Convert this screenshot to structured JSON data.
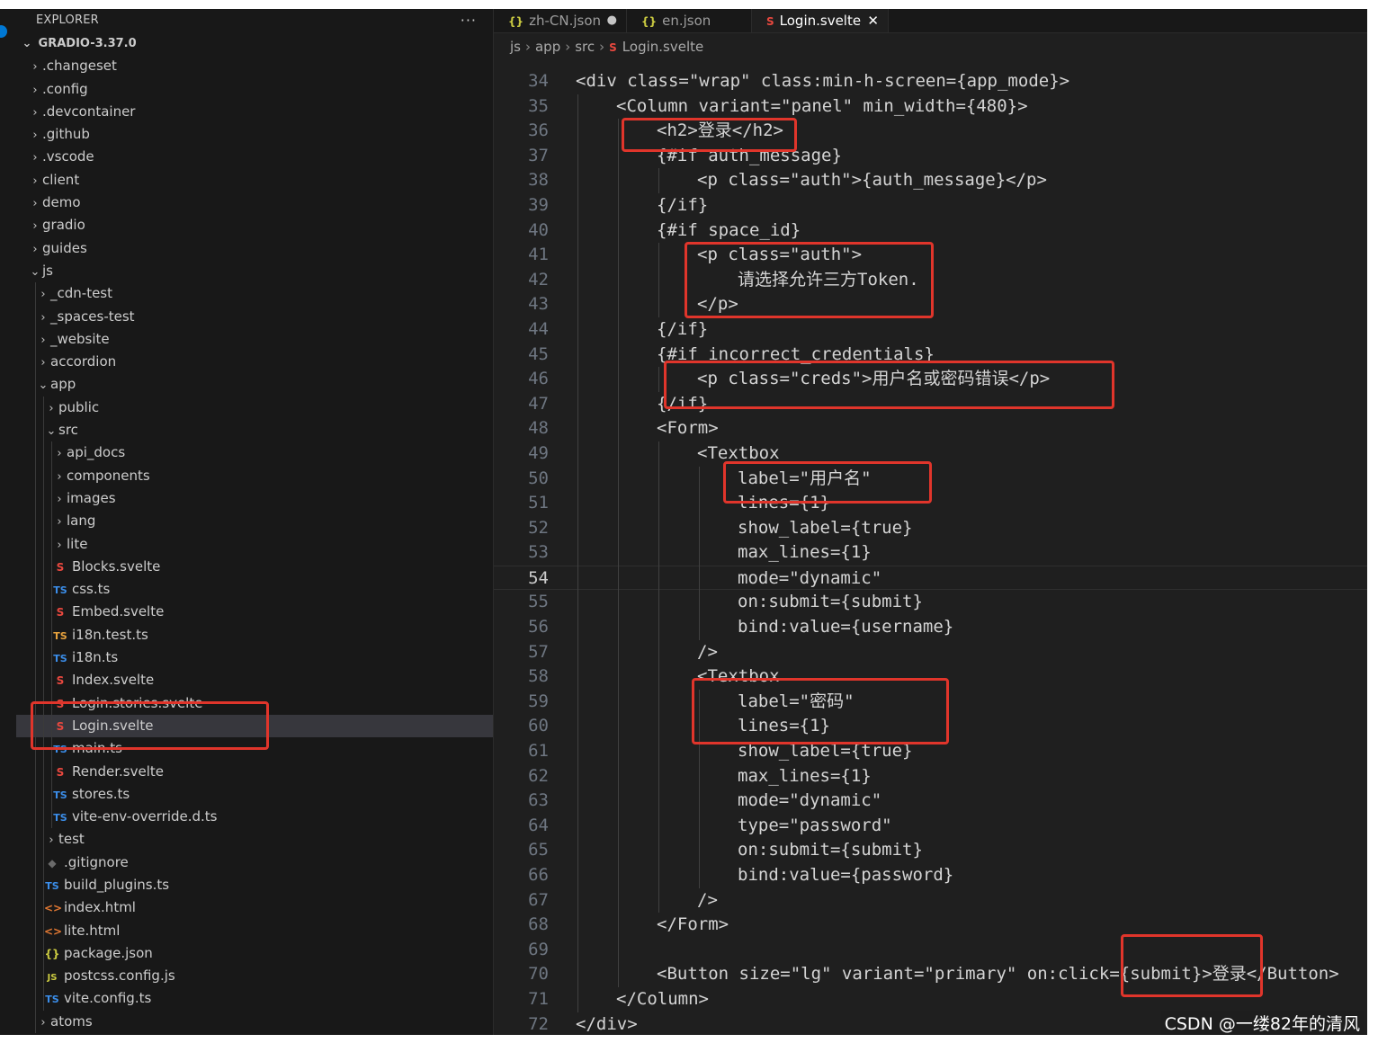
{
  "sidebar": {
    "title": "EXPLORER",
    "more": "···",
    "root": "GRADIO-3.37.0",
    "items": [
      {
        "label": ".changeset",
        "type": "folder",
        "depth": 1,
        "open": false
      },
      {
        "label": ".config",
        "type": "folder",
        "depth": 1,
        "open": false
      },
      {
        "label": ".devcontainer",
        "type": "folder",
        "depth": 1,
        "open": false
      },
      {
        "label": ".github",
        "type": "folder",
        "depth": 1,
        "open": false
      },
      {
        "label": ".vscode",
        "type": "folder",
        "depth": 1,
        "open": false
      },
      {
        "label": "client",
        "type": "folder",
        "depth": 1,
        "open": false
      },
      {
        "label": "demo",
        "type": "folder",
        "depth": 1,
        "open": false
      },
      {
        "label": "gradio",
        "type": "folder",
        "depth": 1,
        "open": false
      },
      {
        "label": "guides",
        "type": "folder",
        "depth": 1,
        "open": false
      },
      {
        "label": "js",
        "type": "folder",
        "depth": 1,
        "open": true
      },
      {
        "label": "_cdn-test",
        "type": "folder",
        "depth": 2,
        "open": false
      },
      {
        "label": "_spaces-test",
        "type": "folder",
        "depth": 2,
        "open": false
      },
      {
        "label": "_website",
        "type": "folder",
        "depth": 2,
        "open": false
      },
      {
        "label": "accordion",
        "type": "folder",
        "depth": 2,
        "open": false
      },
      {
        "label": "app",
        "type": "folder",
        "depth": 2,
        "open": true
      },
      {
        "label": "public",
        "type": "folder",
        "depth": 3,
        "open": false
      },
      {
        "label": "src",
        "type": "folder",
        "depth": 3,
        "open": true
      },
      {
        "label": "api_docs",
        "type": "folder",
        "depth": 4,
        "open": false
      },
      {
        "label": "components",
        "type": "folder",
        "depth": 4,
        "open": false
      },
      {
        "label": "images",
        "type": "folder",
        "depth": 4,
        "open": false
      },
      {
        "label": "lang",
        "type": "folder",
        "depth": 4,
        "open": false
      },
      {
        "label": "lite",
        "type": "folder",
        "depth": 4,
        "open": false
      },
      {
        "label": "Blocks.svelte",
        "type": "svelte",
        "depth": 4
      },
      {
        "label": "css.ts",
        "type": "ts",
        "depth": 4
      },
      {
        "label": "Embed.svelte",
        "type": "svelte",
        "depth": 4
      },
      {
        "label": "i18n.test.ts",
        "type": "ts-test",
        "depth": 4
      },
      {
        "label": "i18n.ts",
        "type": "ts",
        "depth": 4
      },
      {
        "label": "Index.svelte",
        "type": "svelte",
        "depth": 4
      },
      {
        "label": "Login.stories.svelte",
        "type": "svelte",
        "depth": 4
      },
      {
        "label": "Login.svelte",
        "type": "svelte",
        "depth": 4,
        "selected": true
      },
      {
        "label": "main.ts",
        "type": "ts",
        "depth": 4
      },
      {
        "label": "Render.svelte",
        "type": "svelte",
        "depth": 4
      },
      {
        "label": "stores.ts",
        "type": "ts",
        "depth": 4
      },
      {
        "label": "vite-env-override.d.ts",
        "type": "ts",
        "depth": 4
      },
      {
        "label": "test",
        "type": "folder",
        "depth": 3,
        "open": false
      },
      {
        "label": ".gitignore",
        "type": "git",
        "depth": 3
      },
      {
        "label": "build_plugins.ts",
        "type": "ts",
        "depth": 3
      },
      {
        "label": "index.html",
        "type": "html",
        "depth": 3
      },
      {
        "label": "lite.html",
        "type": "html",
        "depth": 3
      },
      {
        "label": "package.json",
        "type": "json",
        "depth": 3
      },
      {
        "label": "postcss.config.js",
        "type": "js",
        "depth": 3
      },
      {
        "label": "vite.config.ts",
        "type": "ts",
        "depth": 3
      },
      {
        "label": "atoms",
        "type": "folder",
        "depth": 2,
        "open": false
      }
    ]
  },
  "icons": {
    "chevron_right": "›",
    "chevron_down": "⌄",
    "ts": "TS",
    "svelte": "S",
    "json": "{}",
    "js": "JS",
    "html": "<>",
    "git": "◆",
    "close": "✕",
    "modified_dot": "●"
  },
  "tabs": [
    {
      "label": "zh-CN.json",
      "icon": "{}",
      "modified": true,
      "active": false
    },
    {
      "label": "en.json",
      "icon": "{}",
      "modified": false,
      "active": false
    },
    {
      "label": "Login.svelte",
      "icon": "S",
      "modified": false,
      "active": true
    }
  ],
  "breadcrumbs": [
    "js",
    "app",
    "src",
    "Login.svelte"
  ],
  "code": {
    "current_line": 54,
    "lines": [
      {
        "n": 34,
        "indent": 0,
        "text": "<div class=\"wrap\" class:min-h-screen={app_mode}>"
      },
      {
        "n": 35,
        "indent": 1,
        "text": "<Column variant=\"panel\" min_width={480}>"
      },
      {
        "n": 36,
        "indent": 2,
        "text": "<h2>登录</h2>"
      },
      {
        "n": 37,
        "indent": 2,
        "text": "{#if auth_message}"
      },
      {
        "n": 38,
        "indent": 3,
        "text": "<p class=\"auth\">{auth_message}</p>"
      },
      {
        "n": 39,
        "indent": 2,
        "text": "{/if}"
      },
      {
        "n": 40,
        "indent": 2,
        "text": "{#if space_id}"
      },
      {
        "n": 41,
        "indent": 3,
        "text": "<p class=\"auth\">"
      },
      {
        "n": 42,
        "indent": 4,
        "text": "请选择允许三方Token."
      },
      {
        "n": 43,
        "indent": 3,
        "text": "</p>"
      },
      {
        "n": 44,
        "indent": 2,
        "text": "{/if}"
      },
      {
        "n": 45,
        "indent": 2,
        "text": "{#if incorrect_credentials}"
      },
      {
        "n": 46,
        "indent": 3,
        "text": "<p class=\"creds\">用户名或密码错误</p>"
      },
      {
        "n": 47,
        "indent": 2,
        "text": "{/if}"
      },
      {
        "n": 48,
        "indent": 2,
        "text": "<Form>"
      },
      {
        "n": 49,
        "indent": 3,
        "text": "<Textbox"
      },
      {
        "n": 50,
        "indent": 4,
        "text": "label=\"用户名\""
      },
      {
        "n": 51,
        "indent": 4,
        "text": "lines={1}"
      },
      {
        "n": 52,
        "indent": 4,
        "text": "show_label={true}"
      },
      {
        "n": 53,
        "indent": 4,
        "text": "max_lines={1}"
      },
      {
        "n": 54,
        "indent": 4,
        "text": "mode=\"dynamic\""
      },
      {
        "n": 55,
        "indent": 4,
        "text": "on:submit={submit}"
      },
      {
        "n": 56,
        "indent": 4,
        "text": "bind:value={username}"
      },
      {
        "n": 57,
        "indent": 3,
        "text": "/>"
      },
      {
        "n": 58,
        "indent": 3,
        "text": "<Textbox"
      },
      {
        "n": 59,
        "indent": 4,
        "text": "label=\"密码\""
      },
      {
        "n": 60,
        "indent": 4,
        "text": "lines={1}"
      },
      {
        "n": 61,
        "indent": 4,
        "text": "show_label={true}"
      },
      {
        "n": 62,
        "indent": 4,
        "text": "max_lines={1}"
      },
      {
        "n": 63,
        "indent": 4,
        "text": "mode=\"dynamic\""
      },
      {
        "n": 64,
        "indent": 4,
        "text": "type=\"password\""
      },
      {
        "n": 65,
        "indent": 4,
        "text": "on:submit={submit}"
      },
      {
        "n": 66,
        "indent": 4,
        "text": "bind:value={password}"
      },
      {
        "n": 67,
        "indent": 3,
        "text": "/>"
      },
      {
        "n": 68,
        "indent": 2,
        "text": "</Form>"
      },
      {
        "n": 69,
        "indent": 0,
        "text": ""
      },
      {
        "n": 70,
        "indent": 2,
        "text": "<Button size=\"lg\" variant=\"primary\" on:click={submit}>登录</Button>"
      },
      {
        "n": 71,
        "indent": 1,
        "text": "</Column>"
      },
      {
        "n": 72,
        "indent": 0,
        "text": "</div>"
      }
    ]
  },
  "colors": {
    "highlight_box": "#e0352b"
  },
  "watermark": "CSDN @一缕82年的清风"
}
